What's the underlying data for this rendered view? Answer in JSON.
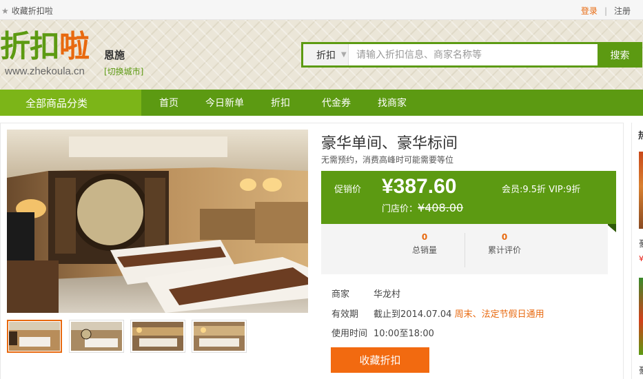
{
  "topbar": {
    "favorite_label": "收藏折扣啦",
    "login": "登录",
    "separator": "|",
    "register": "注册"
  },
  "header": {
    "logo": {
      "chars": [
        "折",
        "扣",
        "啦"
      ],
      "url": "www.zhekoula.cn"
    },
    "city": "恩施",
    "switch_city": "[切换城市]",
    "search": {
      "category": "折扣",
      "placeholder": "请输入折扣信息、商家名称等",
      "button": "搜索"
    }
  },
  "nav": {
    "all_categories": "全部商品分类",
    "items": [
      "首页",
      "今日新单",
      "折扣",
      "代金券",
      "找商家"
    ]
  },
  "product": {
    "title": "豪华单间、豪华标间",
    "subtitle": "无需预约，消费高峰时可能需要等位",
    "price_label": "促销价",
    "price": "¥387.60",
    "store_price_label": "门店价：",
    "store_price": "¥408.00",
    "vip_info": "会员:9.5折 VIP:9折",
    "stats": [
      {
        "value": "0",
        "label": "总销量"
      },
      {
        "value": "0",
        "label": "累计评价"
      }
    ],
    "merchant_label": "商家",
    "merchant": "华龙村",
    "validity_label": "有效期",
    "validity": "截止到2014.07.04",
    "validity_note": "周末、法定节假日通用",
    "hours_label": "使用时间",
    "hours": "10:00至18:00",
    "favorite_button": "收藏折扣"
  },
  "sidebar": {
    "heading": "热",
    "item1_title": "豪",
    "item1_price": "¥",
    "item2_title": "豪"
  },
  "colors": {
    "brand_green": "#5c9a12",
    "light_green": "#7cb518",
    "accent_orange": "#e8690f",
    "button_orange": "#f26a10"
  }
}
